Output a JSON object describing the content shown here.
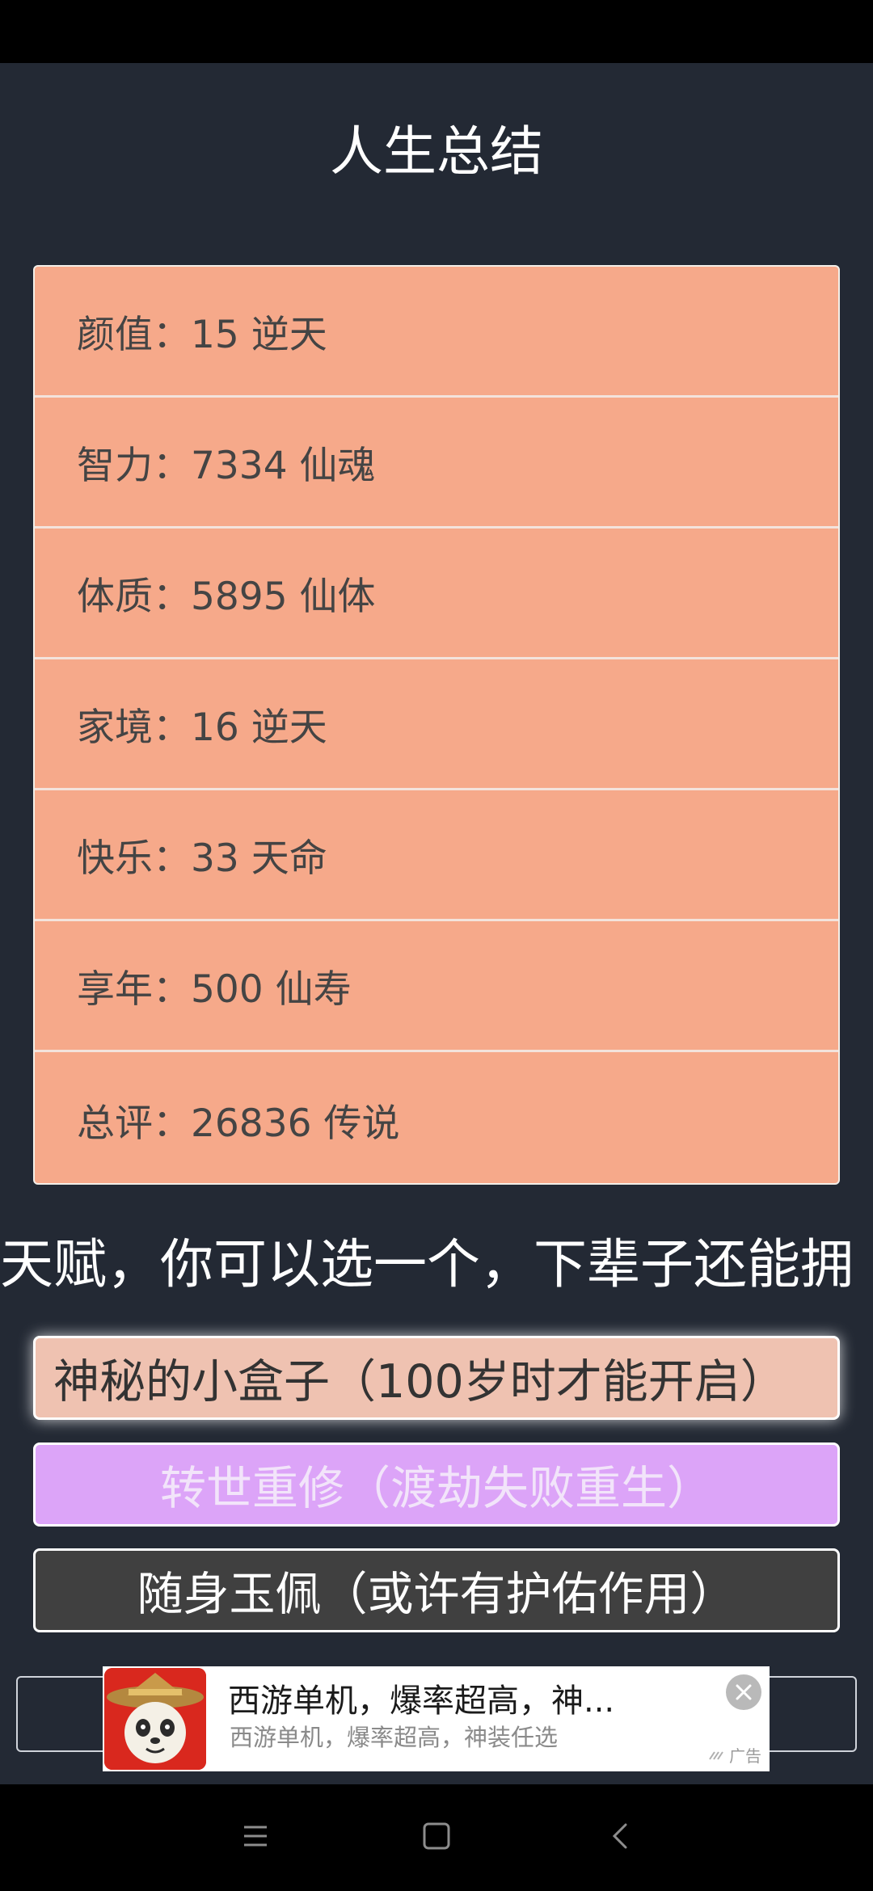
{
  "page": {
    "title": "人生总结"
  },
  "stats": [
    {
      "label": "颜值：",
      "value": "15 逆天"
    },
    {
      "label": "智力：",
      "value": "7334 仙魂"
    },
    {
      "label": "体质：",
      "value": "5895 仙体"
    },
    {
      "label": "家境：",
      "value": "16 逆天"
    },
    {
      "label": "快乐：",
      "value": "33 天命"
    },
    {
      "label": "享年：",
      "value": "500 仙寿"
    },
    {
      "label": "总评：",
      "value": "26836 传说"
    }
  ],
  "talent_prompt": "天赋，你可以选一个，下辈子还能拥",
  "options": [
    {
      "label": "神秘的小盒子（100岁时才能开启）"
    },
    {
      "label": "转世重修（渡劫失败重生）"
    },
    {
      "label": "随身玉佩（或许有护佑作用）"
    }
  ],
  "ad": {
    "title": "西游单机，爆率超高，神...",
    "subtitle": "西游单机，爆率超高，神装任选",
    "tag": "广告"
  },
  "nav": {
    "icons": [
      "menu-icon",
      "home-icon",
      "back-icon"
    ]
  },
  "colors": {
    "background": "#232934",
    "card": "#f6a98a",
    "option_selected": "#efc2b1",
    "option_purple": "#dca4f8",
    "option_dark": "#404040"
  }
}
